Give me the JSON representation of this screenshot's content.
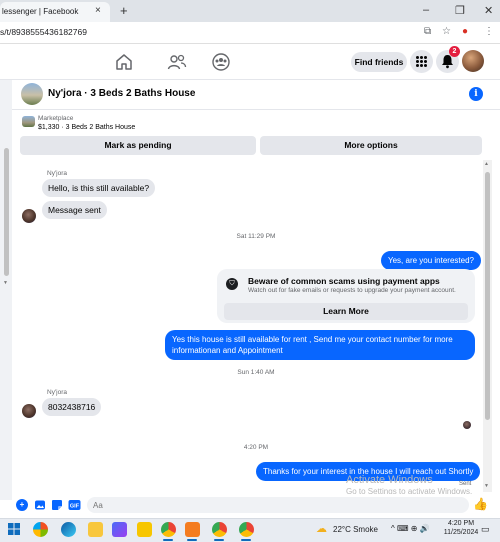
{
  "browser": {
    "tab_title": "lessenger | Facebook",
    "tab_close": "×",
    "new_tab": "+",
    "url": "s/t/8938555436182769",
    "window_controls": [
      "–",
      "❐",
      "✕"
    ]
  },
  "fb_nav": {
    "find_friends_label": "Find friends",
    "notification_count": "2"
  },
  "conversation": {
    "title": "Ny'jora · 3 Beds 2 Baths House",
    "marketplace_label": "Marketplace",
    "listing_subtitle": "$1,330 · 3 Beds 2 Baths House",
    "mark_pending_label": "Mark as pending",
    "more_options_label": "More options",
    "messages": {
      "sender_1": "Ny'jora",
      "msg_1": "Hello, is this still available?",
      "msg_2": "Message sent",
      "time_1": "Sat 11:29 PM",
      "msg_3": "Yes, are you interested?",
      "msg_5": "Yes this house is still available for rent , Send me your contact number for more informationan and Appointment",
      "time_2": "Sun 1:40 AM",
      "sender_2": "Ny'jora",
      "msg_6": "8032438716",
      "time_3": "4:20 PM",
      "msg_7": "Thanks for your interest in the house I will reach out Shortly",
      "sent_status": "Sent"
    },
    "scam_warning": {
      "title": "Beware of common scams using payment apps",
      "description": "Watch out for fake emails or requests to upgrade your payment account.",
      "learn_more_label": "Learn More"
    },
    "composer_value": "Aa"
  },
  "windows": {
    "activate_line_1": "Activate Windows",
    "activate_line_2": "Go to Settings to activate Windows.",
    "weather": "22°C  Smoke",
    "time": "4:20 PM",
    "date": "11/25/2024"
  }
}
